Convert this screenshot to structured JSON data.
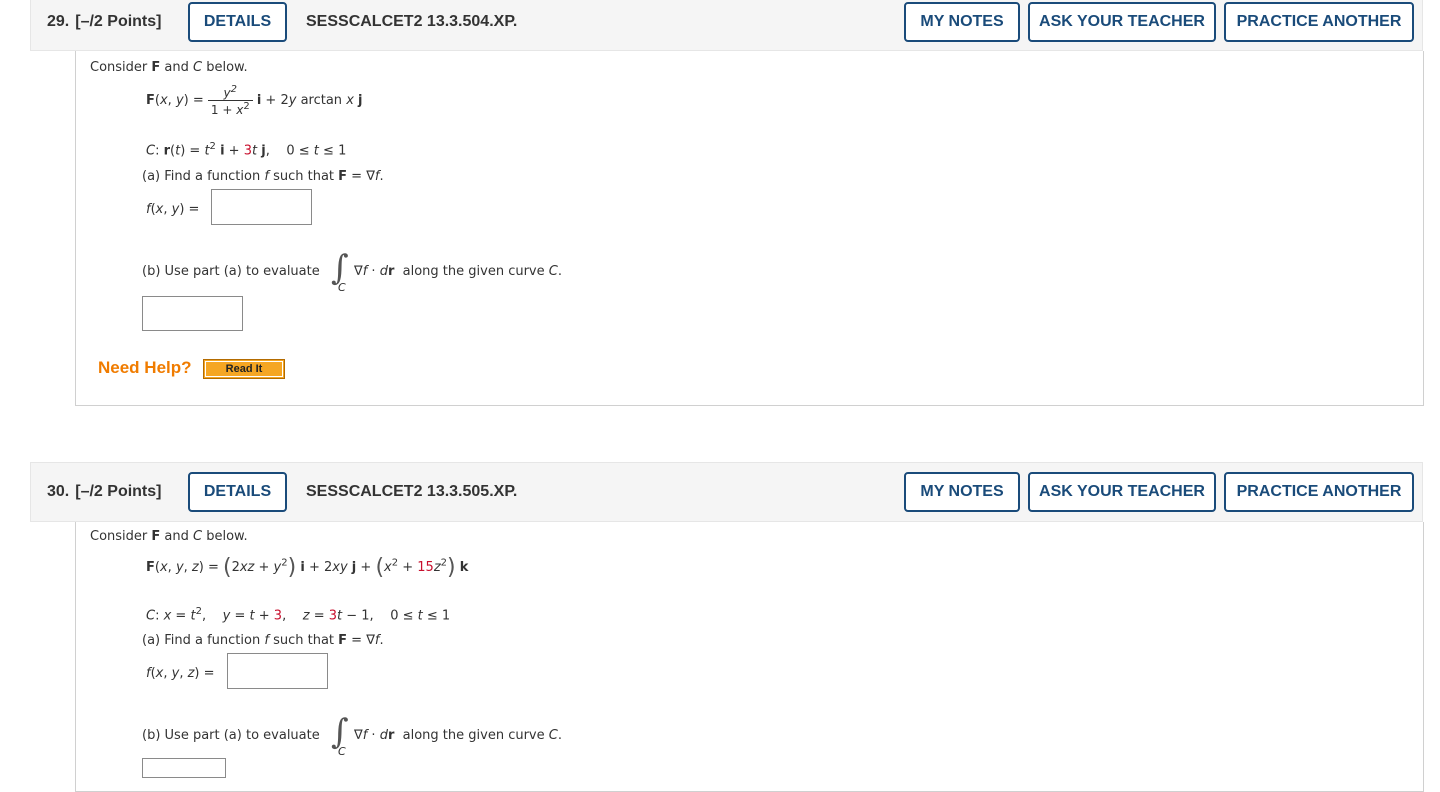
{
  "q29": {
    "number": "29.",
    "points": "[–/2 Points]",
    "details": "DETAILS",
    "id": "SESSCALCET2 13.3.504.XP.",
    "my_notes": "MY NOTES",
    "ask": "ASK YOUR TEACHER",
    "practice": "PRACTICE ANOTHER",
    "consider": "Consider F and C below.",
    "F_lhs": "F(x, y) =",
    "F_num": "y²",
    "F_den": "1 + x²",
    "F_rest": "i + 2y arctan x j",
    "C_def_a": "C: r(t) = t² i + ",
    "C_def_red": "3",
    "C_def_b": "t j,   0 ≤ t ≤ 1",
    "part_a": "(a) Find a function f such that F = ∇f.",
    "f_label": "f(x, y) =",
    "f_value": "",
    "part_b": "(b) Use part (a) to evaluate",
    "integral_sub": "C",
    "integral_text": "∇f · dr  along the given curve C.",
    "b_value": "",
    "need_help": "Need Help?",
    "read_it": "Read It"
  },
  "q30": {
    "number": "30.",
    "points": "[–/2 Points]",
    "details": "DETAILS",
    "id": "SESSCALCET2 13.3.505.XP.",
    "my_notes": "MY NOTES",
    "ask": "ASK YOUR TEACHER",
    "practice": "PRACTICE ANOTHER",
    "consider": "Consider F and C below.",
    "F_lhs": "F(x, y, z) =",
    "F_p1": "2xz + y²",
    "F_mid": "i + 2xy j +",
    "F_p2a": "x² + ",
    "F_p2red": "15",
    "F_p2b": "z²",
    "F_end": "k",
    "C_x": "C: x = t²,",
    "C_y_a": "y = t + ",
    "C_y_red": "3",
    "C_y_b": ",",
    "C_z_a": "z = ",
    "C_z_red": "3",
    "C_z_b": "t − 1,",
    "C_range": "0 ≤ t ≤ 1",
    "part_a": "(a) Find a function f such that F = ∇f.",
    "f_label": "f(x, y, z) =",
    "f_value": "",
    "part_b": "(b) Use part (a) to evaluate",
    "integral_sub": "C",
    "integral_text": "∇f · dr  along the given curve C.",
    "b_value": ""
  }
}
